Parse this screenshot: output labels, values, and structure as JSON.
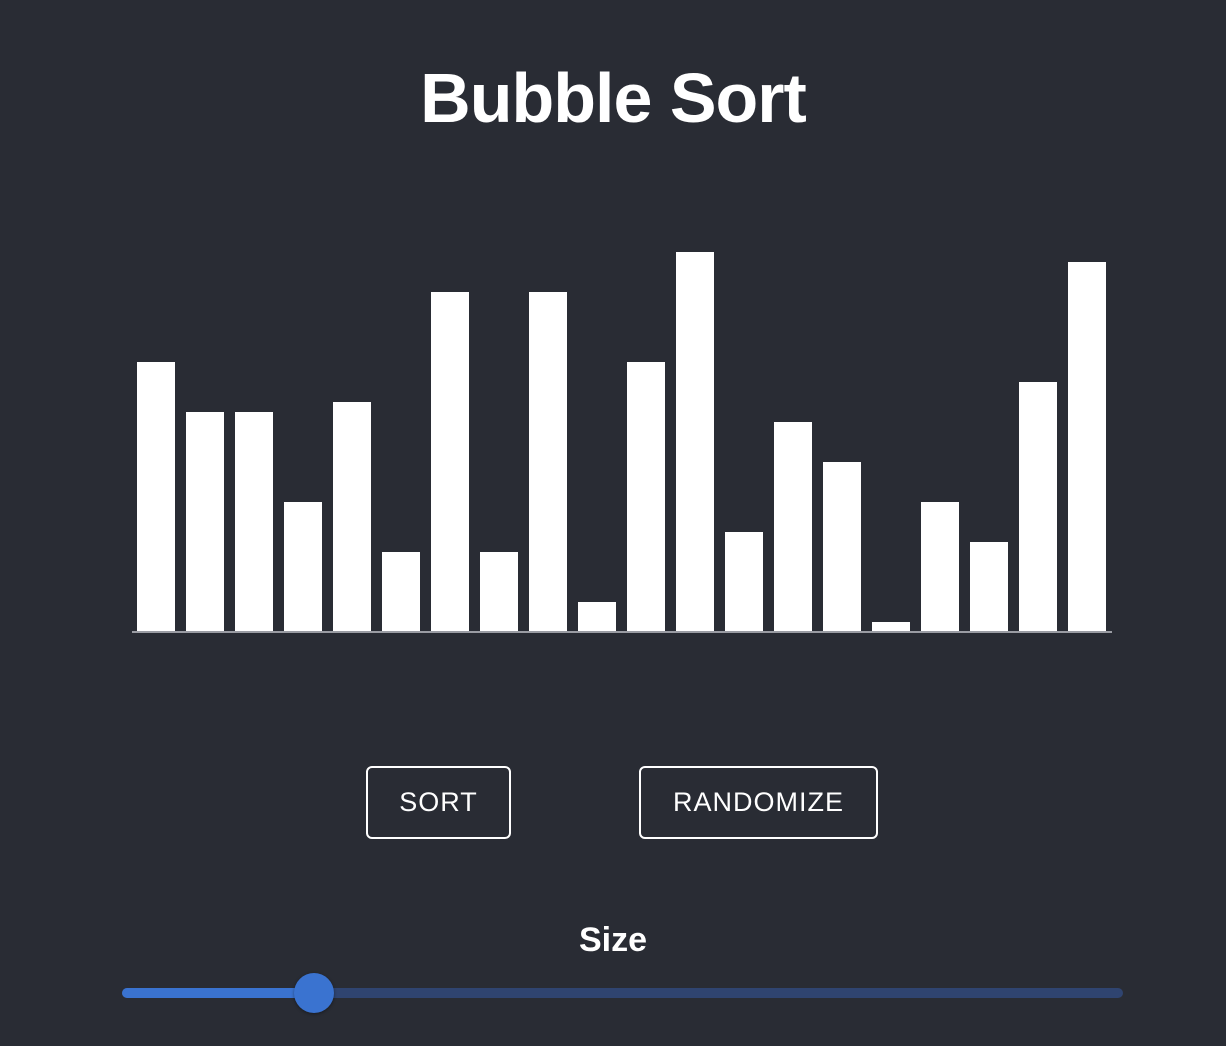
{
  "header": {
    "title": "Bubble Sort"
  },
  "chart_data": {
    "type": "bar",
    "values": [
      270,
      220,
      220,
      130,
      230,
      80,
      340,
      80,
      340,
      30,
      270,
      380,
      100,
      210,
      170,
      10,
      130,
      90,
      250,
      370
    ],
    "ylim": [
      0,
      400
    ],
    "bar_color": "#ffffff",
    "baseline_color": "#9a9ca3"
  },
  "controls": {
    "sort_label": "SORT",
    "randomize_label": "RANDOMIZE"
  },
  "size_slider": {
    "label": "Size",
    "value_fraction": 0.192,
    "fill_color": "#3a73d0",
    "track_color": "#2f4470"
  },
  "colors": {
    "background": "#292c34",
    "text": "#ffffff",
    "accent": "#3a73d0"
  }
}
